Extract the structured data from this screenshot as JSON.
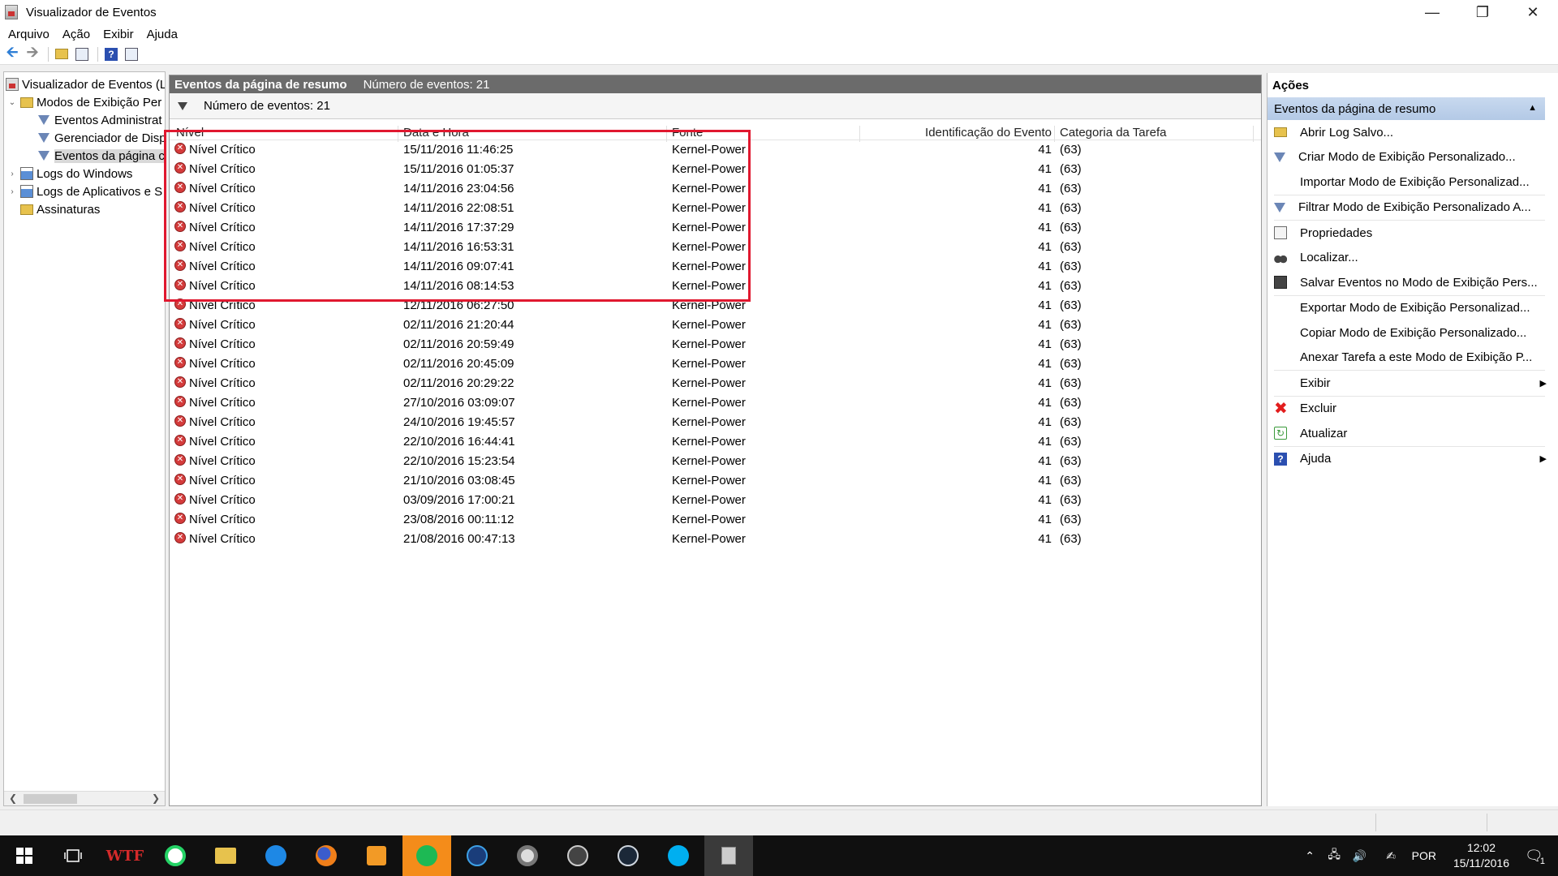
{
  "window": {
    "title": "Visualizador de Eventos"
  },
  "menu": [
    "Arquivo",
    "Ação",
    "Exibir",
    "Ajuda"
  ],
  "tree": [
    {
      "label": "Visualizador de Eventos (L",
      "level": 0,
      "toggle": "",
      "icon": "event-viewer-icon"
    },
    {
      "label": "Modos de Exibição Per",
      "level": 0,
      "toggle": "⌄",
      "icon": "folder-icon"
    },
    {
      "label": "Eventos Administrat",
      "level": 1,
      "toggle": "",
      "icon": "filter-icon"
    },
    {
      "label": "Gerenciador de Disp",
      "level": 1,
      "toggle": "",
      "icon": "filter-icon"
    },
    {
      "label": "Eventos da página c",
      "level": 1,
      "toggle": "",
      "icon": "filter-icon",
      "selected": true
    },
    {
      "label": "Logs do Windows",
      "level": 0,
      "toggle": "›",
      "icon": "log-icon"
    },
    {
      "label": "Logs de Aplicativos e S",
      "level": 0,
      "toggle": "›",
      "icon": "log-icon"
    },
    {
      "label": "Assinaturas",
      "level": 0,
      "toggle": "",
      "icon": "subscription-icon"
    }
  ],
  "center": {
    "title": "Eventos da página de resumo",
    "count_label": "Número de eventos: 21",
    "filter_label": "Número de eventos: 21",
    "columns": [
      "Nível",
      "Data e Hora",
      "Fonte",
      "Identificação do Evento",
      "Categoria da Tarefa"
    ],
    "rows": [
      [
        "Nível Crítico",
        "15/11/2016 11:46:25",
        "Kernel-Power",
        "41",
        "(63)"
      ],
      [
        "Nível Crítico",
        "15/11/2016 01:05:37",
        "Kernel-Power",
        "41",
        "(63)"
      ],
      [
        "Nível Crítico",
        "14/11/2016 23:04:56",
        "Kernel-Power",
        "41",
        "(63)"
      ],
      [
        "Nível Crítico",
        "14/11/2016 22:08:51",
        "Kernel-Power",
        "41",
        "(63)"
      ],
      [
        "Nível Crítico",
        "14/11/2016 17:37:29",
        "Kernel-Power",
        "41",
        "(63)"
      ],
      [
        "Nível Crítico",
        "14/11/2016 16:53:31",
        "Kernel-Power",
        "41",
        "(63)"
      ],
      [
        "Nível Crítico",
        "14/11/2016 09:07:41",
        "Kernel-Power",
        "41",
        "(63)"
      ],
      [
        "Nível Crítico",
        "14/11/2016 08:14:53",
        "Kernel-Power",
        "41",
        "(63)"
      ],
      [
        "Nível Crítico",
        "12/11/2016 06:27:50",
        "Kernel-Power",
        "41",
        "(63)"
      ],
      [
        "Nível Crítico",
        "02/11/2016 21:20:44",
        "Kernel-Power",
        "41",
        "(63)"
      ],
      [
        "Nível Crítico",
        "02/11/2016 20:59:49",
        "Kernel-Power",
        "41",
        "(63)"
      ],
      [
        "Nível Crítico",
        "02/11/2016 20:45:09",
        "Kernel-Power",
        "41",
        "(63)"
      ],
      [
        "Nível Crítico",
        "02/11/2016 20:29:22",
        "Kernel-Power",
        "41",
        "(63)"
      ],
      [
        "Nível Crítico",
        "27/10/2016 03:09:07",
        "Kernel-Power",
        "41",
        "(63)"
      ],
      [
        "Nível Crítico",
        "24/10/2016 19:45:57",
        "Kernel-Power",
        "41",
        "(63)"
      ],
      [
        "Nível Crítico",
        "22/10/2016 16:44:41",
        "Kernel-Power",
        "41",
        "(63)"
      ],
      [
        "Nível Crítico",
        "22/10/2016 15:23:54",
        "Kernel-Power",
        "41",
        "(63)"
      ],
      [
        "Nível Crítico",
        "21/10/2016 03:08:45",
        "Kernel-Power",
        "41",
        "(63)"
      ],
      [
        "Nível Crítico",
        "03/09/2016 17:00:21",
        "Kernel-Power",
        "41",
        "(63)"
      ],
      [
        "Nível Crítico",
        "23/08/2016 00:11:12",
        "Kernel-Power",
        "41",
        "(63)"
      ],
      [
        "Nível Crítico",
        "21/08/2016 00:47:13",
        "Kernel-Power",
        "41",
        "(63)"
      ]
    ],
    "highlight_color": "#e0182f"
  },
  "actions": {
    "title": "Ações",
    "section": "Eventos da página de resumo",
    "items": [
      {
        "label": "Abrir Log Salvo...",
        "icon": "open-log-icon",
        "submenu": false
      },
      {
        "label": "Criar Modo de Exibição Personalizado...",
        "icon": "create-view-icon",
        "submenu": false
      },
      {
        "label": "Importar Modo de Exibição Personalizad...",
        "icon": "",
        "submenu": false
      },
      {
        "label": "Filtrar Modo de Exibição Personalizado A...",
        "icon": "filter-icon",
        "submenu": false,
        "sep_before": true
      },
      {
        "label": "Propriedades",
        "icon": "properties-icon",
        "submenu": false,
        "sep_before": true
      },
      {
        "label": "Localizar...",
        "icon": "binoculars-icon",
        "submenu": false
      },
      {
        "label": "Salvar Eventos no Modo de Exibição Pers...",
        "icon": "save-icon",
        "submenu": false
      },
      {
        "label": "Exportar Modo de Exibição Personalizad...",
        "icon": "",
        "submenu": false,
        "sep_before": true
      },
      {
        "label": "Copiar Modo de Exibição Personalizado...",
        "icon": "",
        "submenu": false
      },
      {
        "label": "Anexar Tarefa a este Modo de Exibição P...",
        "icon": "",
        "submenu": false
      },
      {
        "label": "Exibir",
        "icon": "",
        "submenu": true,
        "sep_before": true
      },
      {
        "label": "Excluir",
        "icon": "delete-icon",
        "submenu": false,
        "sep_before": true
      },
      {
        "label": "Atualizar",
        "icon": "refresh-icon",
        "submenu": false
      },
      {
        "label": "Ajuda",
        "icon": "help-icon",
        "submenu": true,
        "sep_before": true
      }
    ]
  },
  "taskbar": {
    "apps": [
      "windows-start-icon",
      "task-view-icon",
      "wtf-app-icon",
      "whatsapp-icon",
      "file-explorer-icon",
      "messenger-icon",
      "firefox-icon",
      "media-player-icon",
      "spotify-icon",
      "battlenet-icon",
      "settings-app-icon",
      "game-app-icon",
      "steam-icon",
      "skype-icon",
      "event-viewer-taskbar-icon"
    ],
    "language": "POR",
    "time": "12:02",
    "date": "15/11/2016",
    "notification_count": "1"
  }
}
